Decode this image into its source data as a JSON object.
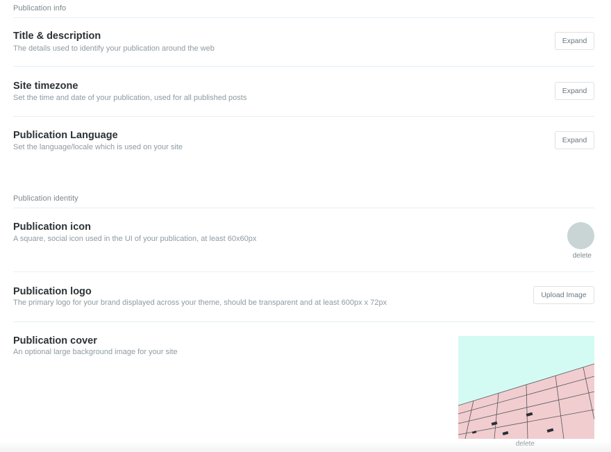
{
  "sections": {
    "info": {
      "header": "Publication info",
      "rows": [
        {
          "title": "Title & description",
          "description": "The details used to identify your publication around the web",
          "button": "Expand"
        },
        {
          "title": "Site timezone",
          "description": "Set the time and date of your publication, used for all published posts",
          "button": "Expand"
        },
        {
          "title": "Publication Language",
          "description": "Set the language/locale which is used on your site",
          "button": "Expand"
        }
      ]
    },
    "identity": {
      "header": "Publication identity",
      "icon": {
        "title": "Publication icon",
        "description": "A square, social icon used in the UI of your publication, at least 60x60px",
        "delete_label": "delete",
        "icon_color": "#c9d4d5"
      },
      "logo": {
        "title": "Publication logo",
        "description": "The primary logo for your brand displayed across your theme, should be transparent and at least 600px x 72px",
        "button": "Upload Image"
      },
      "cover": {
        "title": "Publication cover",
        "description": "An optional large background image for your site",
        "delete_label": "delete"
      }
    }
  },
  "colors": {
    "sky": "#d4fbf3",
    "wall": "#f1cdd0",
    "grid": "#3a3f44"
  }
}
